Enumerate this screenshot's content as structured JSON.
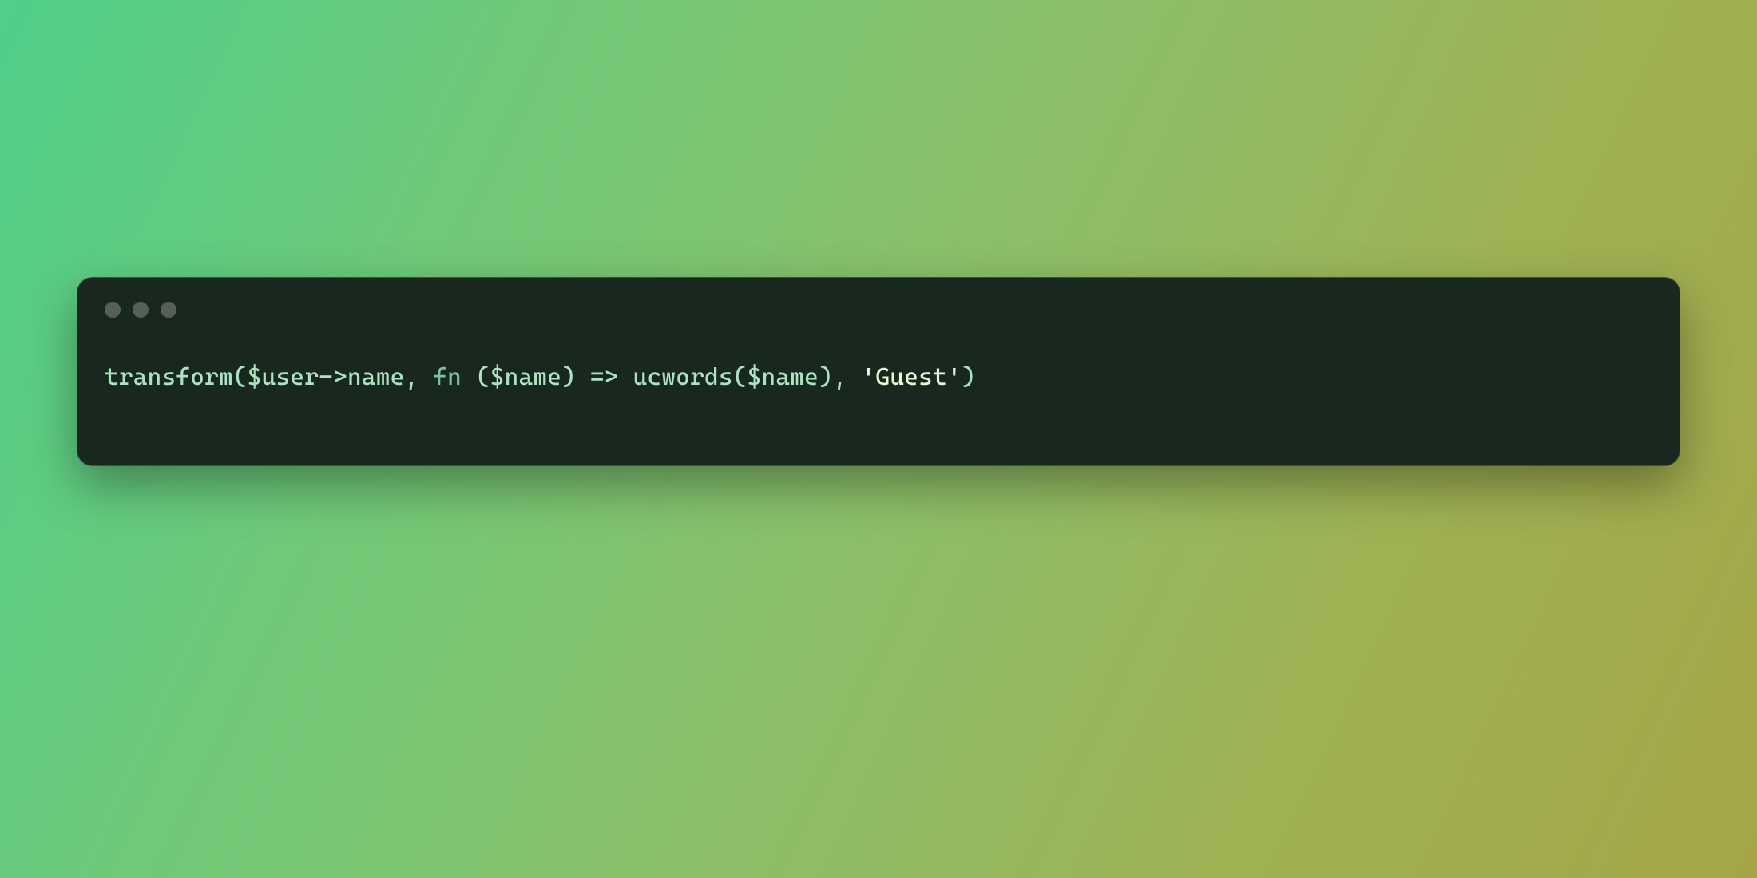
{
  "code": {
    "tokens": {
      "t1": "transform",
      "t2": "(",
      "t3": "$user",
      "t4": "->",
      "t5": "name",
      "t6": ", ",
      "t7": "fn",
      "t8": " (",
      "t9": "$name",
      "t10": ") ",
      "t11": "=>",
      "t12": " ",
      "t13": "ucwords",
      "t14": "(",
      "t15": "$name",
      "t16": ")",
      "t17": ", ",
      "t18": "'Guest'",
      "t19": ")"
    }
  }
}
